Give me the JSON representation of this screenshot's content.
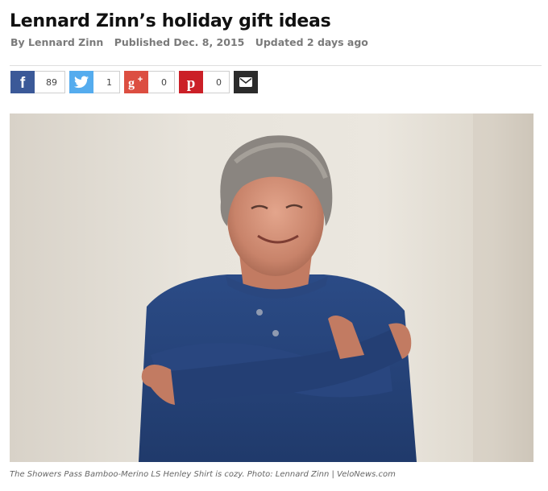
{
  "article": {
    "title": "Lennard Zinn’s holiday gift ideas",
    "byline": "By Lennard Zinn",
    "published": "Published Dec. 8, 2015",
    "updated": "Updated 2 days ago"
  },
  "share": {
    "facebook": {
      "icon": "facebook-icon",
      "count": "89",
      "color": "#3b5998"
    },
    "twitter": {
      "icon": "twitter-icon",
      "count": "1",
      "color": "#55acee"
    },
    "googleplus": {
      "icon": "google-plus-icon",
      "count": "0",
      "color": "#dc4e41"
    },
    "pinterest": {
      "icon": "pinterest-icon",
      "count": "0",
      "color": "#cb2027"
    },
    "email": {
      "icon": "email-icon",
      "color": "#2b2b2b"
    }
  },
  "photo": {
    "caption": "The Showers Pass Bamboo-Merino LS Henley Shirt is cozy. Photo: Lennard Zinn | VeloNews.com"
  }
}
